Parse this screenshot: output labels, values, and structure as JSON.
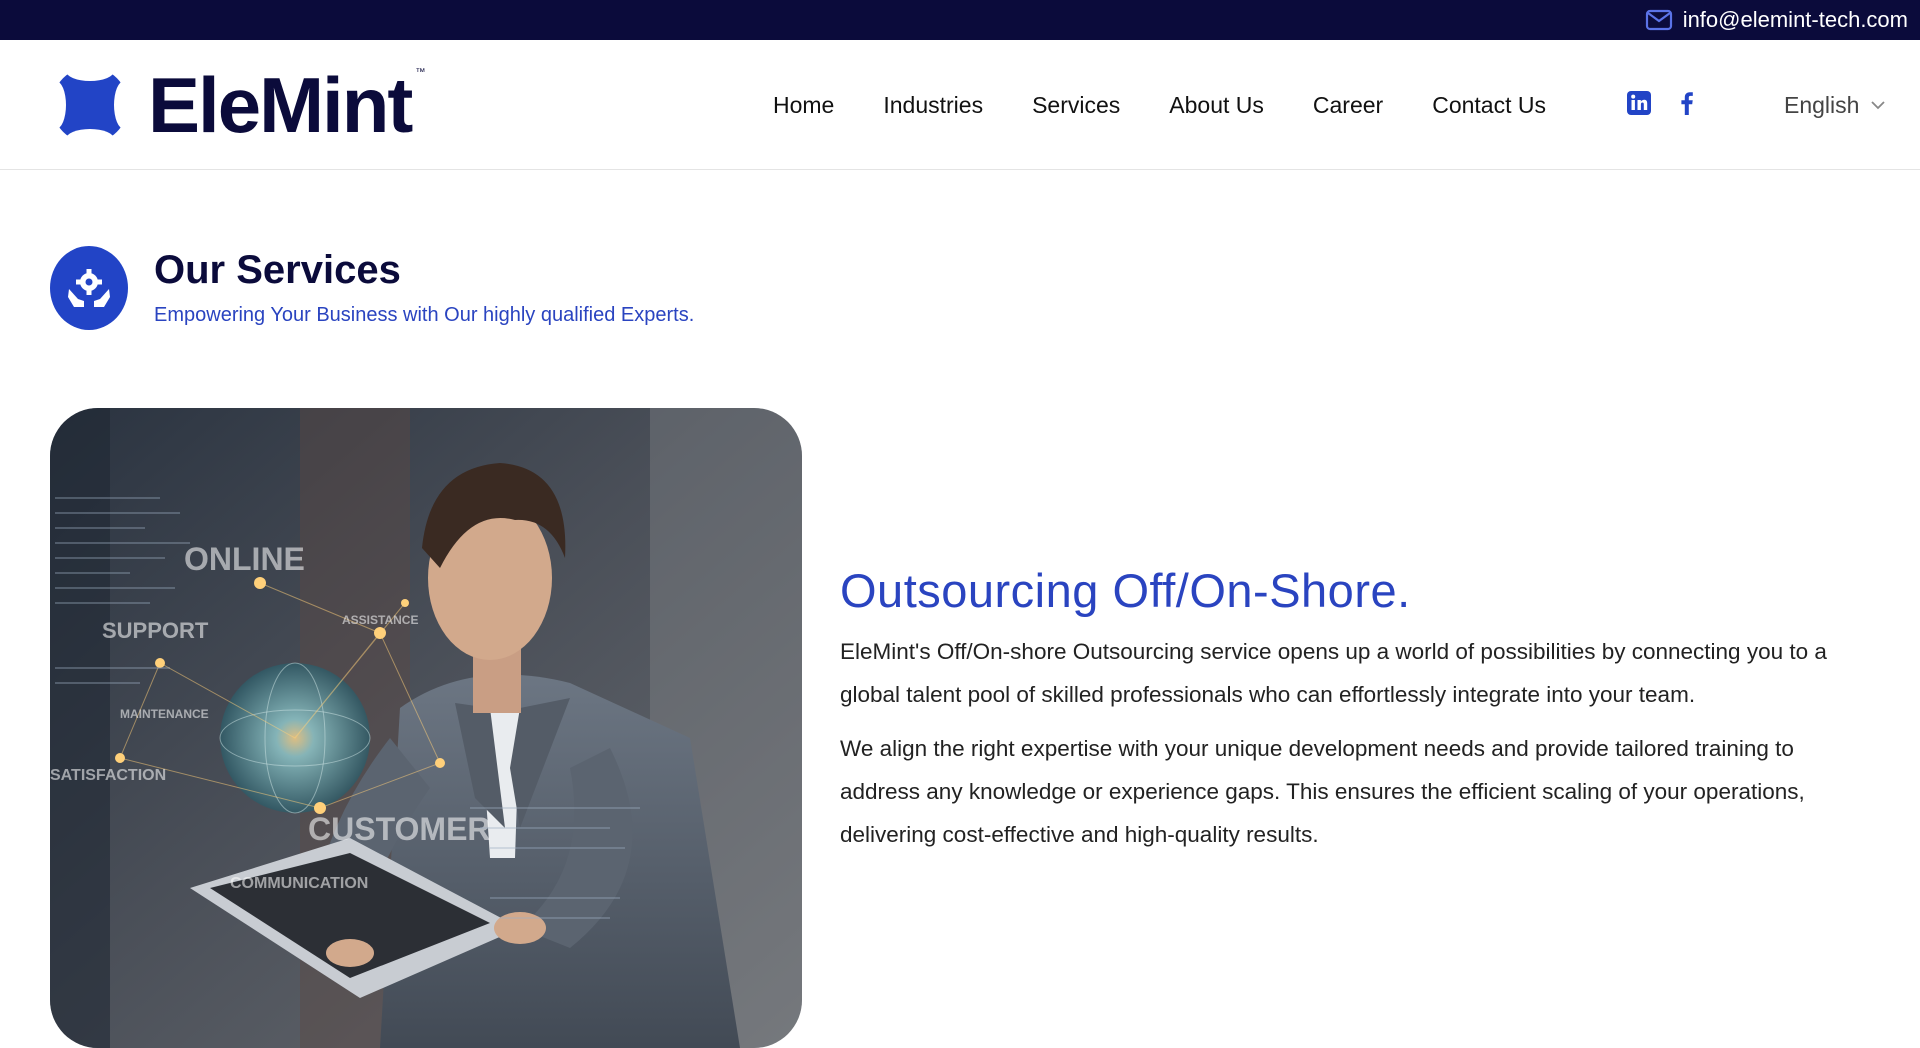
{
  "topbar": {
    "email": "info@elemint-tech.com",
    "icon": "mail-icon"
  },
  "brand": {
    "name": "EleMint",
    "trademark": "™",
    "colors": {
      "navy": "#0b0b3b",
      "blue": "#2244c6"
    }
  },
  "nav": {
    "items": [
      {
        "label": "Home"
      },
      {
        "label": "Industries"
      },
      {
        "label": "Services"
      },
      {
        "label": "About Us"
      },
      {
        "label": "Career"
      },
      {
        "label": "Contact Us"
      }
    ]
  },
  "social": {
    "icons": [
      "linkedin-icon",
      "facebook-icon"
    ]
  },
  "language": {
    "selected": "English"
  },
  "section": {
    "title": "Our Services",
    "subtitle": "Empowering Your Business with Our highly qualified Experts."
  },
  "hero": {
    "overlay_words": [
      "ONLINE",
      "SUPPORT",
      "CUSTOMER",
      "SATISFACTION",
      "COMMUNICATION",
      "MAINTENANCE",
      "ASSISTANCE"
    ]
  },
  "service": {
    "title": "Outsourcing Off/On-Shore.",
    "paragraphs": [
      "EleMint's Off/On-shore Outsourcing service opens up a world of possibilities by connecting you to a global talent pool of skilled professionals who can effortlessly integrate into your team.",
      "We align the right expertise with your unique development needs and provide tailored training to address any knowledge or experience gaps. This ensures the efficient scaling of your operations, delivering cost-effective and high-quality results."
    ]
  }
}
